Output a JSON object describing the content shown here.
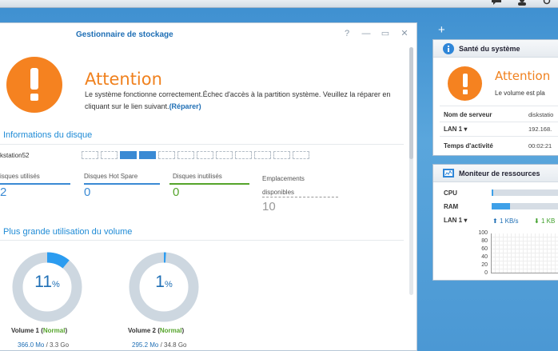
{
  "window": {
    "title": "Gestionnaire de stockage",
    "controls": [
      "?",
      "—",
      "▭",
      "✕"
    ]
  },
  "alert": {
    "title": "Attention",
    "message": "Le système fonctionne correctement.Échec d'accès à la partition système. Veuillez la réparer en cliquant sur le lien suivant.",
    "link": "(Réparer)"
  },
  "disk_info": {
    "section_title": "Informations du disque",
    "device_name": "kstation52",
    "slots_total": 12,
    "slots_used": [
      3,
      4
    ],
    "stats": [
      {
        "label": "isques utilisés",
        "value": "2",
        "color": "#3a8ad4"
      },
      {
        "label": "Disques Hot Spare",
        "value": "0",
        "color": "#3a8ad4"
      },
      {
        "label": "Disques inutilisés",
        "value": "0",
        "color": "#55a42b"
      },
      {
        "label": "Emplacements disponibles",
        "value": "10",
        "color": "#999999"
      }
    ]
  },
  "volumes": {
    "section_title": "Plus grande utilisation du volume",
    "items": [
      {
        "name": "Volume 1",
        "status": "Normal",
        "percent": 11,
        "used": "366.0 Mo",
        "total": "3.3 Go"
      },
      {
        "name": "Volume 2",
        "status": "Normal",
        "percent": 1,
        "used": "295.2 Mo",
        "total": "34.8 Go"
      }
    ]
  },
  "health": {
    "title": "Santé du système",
    "status": "Attention",
    "message": "Le volume est pla",
    "rows": [
      {
        "label": "Nom de serveur",
        "value": "diskstatio"
      },
      {
        "label": "LAN 1 ▾",
        "value": "192.168."
      },
      {
        "label": "Temps d'activité",
        "value": "00:02:21"
      }
    ]
  },
  "resources": {
    "title": "Moniteur de ressources",
    "cpu_label": "CPU",
    "cpu_percent": 2,
    "ram_label": "RAM",
    "ram_percent": 24,
    "lan_label": "LAN 1 ▾",
    "upload": "1 KB/s",
    "download": "1 KB",
    "ticks": [
      "100",
      "80",
      "60",
      "40",
      "20",
      "0"
    ]
  },
  "desktop": {
    "plus_label": "+"
  },
  "colors": {
    "accent": "#1f6fb5",
    "warning": "#f58220",
    "ok": "#55a42b"
  }
}
